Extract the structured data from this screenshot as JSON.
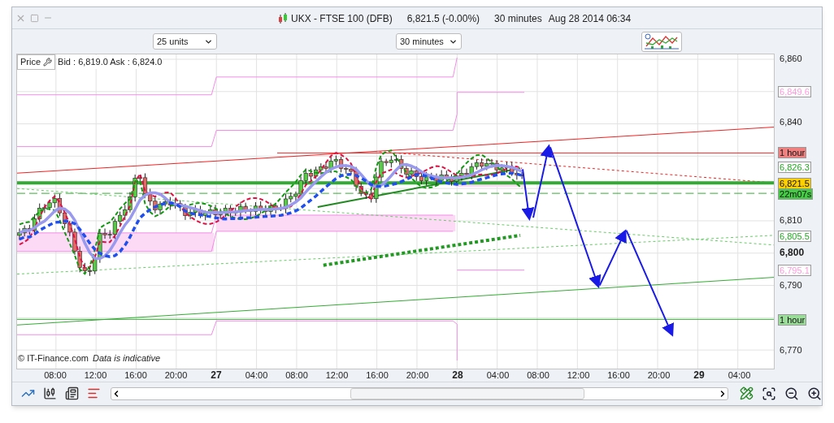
{
  "window": {
    "title": {
      "symbol": "UKX - FTSE 100 (DFB)",
      "price": "6,821.5 (-0.00%)",
      "interval": "30 minutes",
      "datetime": "Aug 28 2014 06:34"
    }
  },
  "toolbar": {
    "units": "25 units",
    "interval": "30 minutes"
  },
  "chart": {
    "label": "Price",
    "quote": "Bid : 6,819.0 Ask : 6,824.0",
    "credit": "© IT-Finance.com",
    "note": "Data is indicative",
    "y_ticks": [
      {
        "label": "6,860",
        "bold": false
      },
      {
        "label": "6,840",
        "bold": false
      },
      {
        "label": "6,810",
        "bold": false
      },
      {
        "label": "6,800",
        "bold": true
      },
      {
        "label": "6,790",
        "bold": false
      },
      {
        "label": "6,770",
        "bold": false
      }
    ],
    "x_ticks": [
      {
        "label": "08:00",
        "bold": false
      },
      {
        "label": "12:00",
        "bold": false
      },
      {
        "label": "16:00",
        "bold": false
      },
      {
        "label": "20:00",
        "bold": false
      },
      {
        "label": "27",
        "bold": true
      },
      {
        "label": "04:00",
        "bold": false
      },
      {
        "label": "08:00",
        "bold": false
      },
      {
        "label": "12:00",
        "bold": false
      },
      {
        "label": "16:00",
        "bold": false
      },
      {
        "label": "20:00",
        "bold": false
      },
      {
        "label": "28",
        "bold": true
      },
      {
        "label": "04:00",
        "bold": false
      },
      {
        "label": "08:00",
        "bold": false
      },
      {
        "label": "12:00",
        "bold": false
      },
      {
        "label": "16:00",
        "bold": false
      },
      {
        "label": "20:00",
        "bold": false
      },
      {
        "label": "29",
        "bold": true
      },
      {
        "label": "04:00",
        "bold": false
      }
    ],
    "markers": [
      {
        "text": "6,849.6",
        "kind": "outline",
        "color": "#ff99dd"
      },
      {
        "text": "1 hour",
        "kind": "filled",
        "color": "#f08080"
      },
      {
        "text": "6,826.3",
        "kind": "outline",
        "color": "#22aa22"
      },
      {
        "text": "6,821.5",
        "kind": "filled",
        "color": "#ffd000"
      },
      {
        "text": "22m07s",
        "kind": "filled",
        "color": "#44cc44"
      },
      {
        "text": "6,805.5",
        "kind": "outline",
        "color": "#22aa22"
      },
      {
        "text": "6,795.1",
        "kind": "outline",
        "color": "#ff99dd"
      },
      {
        "text": "1 hour",
        "kind": "filled",
        "color": "#99dd99"
      }
    ]
  }
}
